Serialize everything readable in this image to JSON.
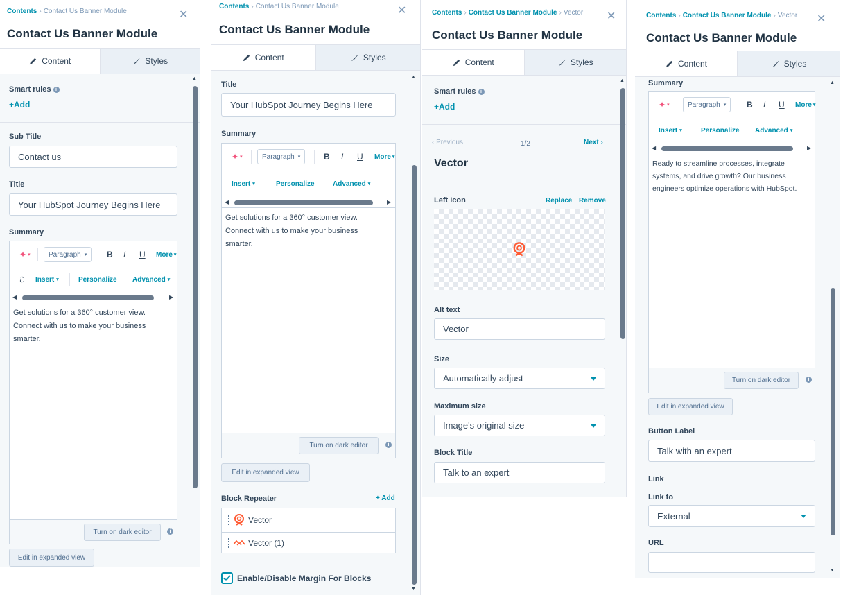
{
  "breadcrumb": {
    "root": "Contents",
    "module": "Contact Us Banner Module",
    "item": "Vector"
  },
  "module_title": "Contact Us Banner Module",
  "tabs": {
    "content": "Content",
    "styles": "Styles"
  },
  "smart_rules": {
    "label": "Smart rules",
    "add": "+Add"
  },
  "sub_title": {
    "label": "Sub Title",
    "value": "Contact us"
  },
  "title": {
    "label": "Title",
    "value": "Your HubSpot Journey Begins Here"
  },
  "summary": {
    "label": "Summary",
    "paragraph": "Paragraph",
    "bold": "B",
    "italic": "I",
    "underline": "U",
    "more": "More",
    "insert": "Insert",
    "personalize": "Personalize",
    "advanced": "Advanced",
    "text_1": "Get solutions for a 360° customer view. Connect with us to make your business smarter.",
    "text_4": "Ready to streamline processes, integrate systems, and drive growth? Our business engineers optimize operations with HubSpot.",
    "dark_editor": "Turn on dark editor",
    "expanded": "Edit in expanded view"
  },
  "block_repeater": {
    "label": "Block Repeater",
    "add": "+ Add",
    "items": [
      "Vector",
      "Vector (1)"
    ]
  },
  "margin_toggle": {
    "label": "Enable/Disable Margin For Blocks",
    "checked": true
  },
  "pager": {
    "previous": "Previous",
    "count": "1/2",
    "next": "Next"
  },
  "vector_heading": "Vector",
  "left_icon": {
    "label": "Left Icon",
    "replace": "Replace",
    "remove": "Remove"
  },
  "alt_text": {
    "label": "Alt text",
    "value": "Vector"
  },
  "size": {
    "label": "Size",
    "value": "Automatically adjust"
  },
  "max_size": {
    "label": "Maximum size",
    "value": "Image's original size"
  },
  "block_title": {
    "label": "Block Title",
    "value": "Talk to an expert"
  },
  "button_label": {
    "label": "Button Label",
    "value": "Talk with an expert"
  },
  "link": {
    "label": "Link",
    "link_to_label": "Link to",
    "link_to_value": "External",
    "url_label": "URL",
    "url_value": ""
  },
  "colors": {
    "accent": "#0091ae",
    "brand": "#ff5c35",
    "text": "#33475b",
    "panel_bg": "#f5f8fa"
  }
}
